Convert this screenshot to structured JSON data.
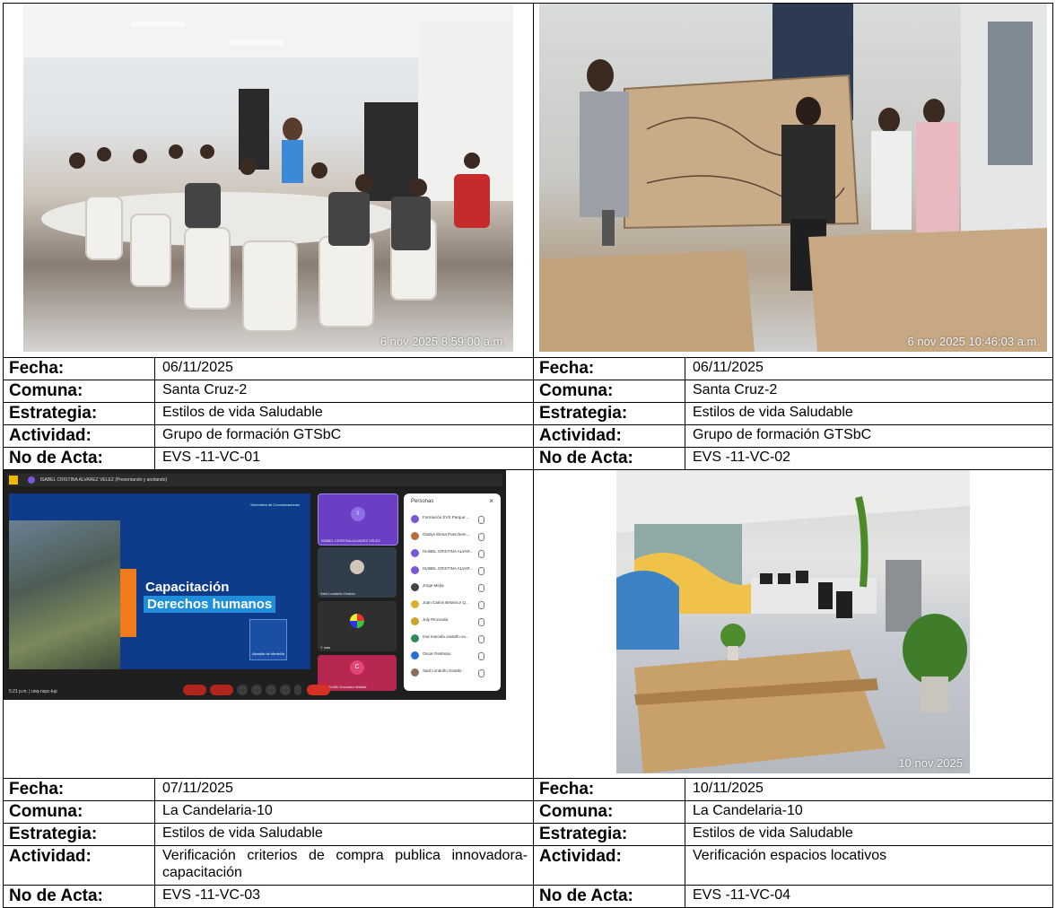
{
  "labels": {
    "fecha": "Fecha:",
    "comuna": "Comuna:",
    "estrategia": "Estrategia:",
    "actividad": "Actividad:",
    "acta": "No de Acta:"
  },
  "records": [
    {
      "photo_stamp": "6 nov 2025 8:59:00 a.m.",
      "fecha": "06/11/2025",
      "comuna": "Santa Cruz-2",
      "estrategia": "Estilos de vida Saludable",
      "actividad": "Grupo de formación GTSbC",
      "acta": "EVS -11-VC-01"
    },
    {
      "photo_stamp": "6 nov 2025 10:46:03 a.m.",
      "fecha": "06/11/2025",
      "comuna": "Santa Cruz-2",
      "estrategia": "Estilos de vida Saludable",
      "actividad": "Grupo de formación GTSbC",
      "acta": "EVS -11-VC-02"
    },
    {
      "fecha": "07/11/2025",
      "comuna": "La Candelaria-10",
      "estrategia": "Estilos de vida Saludable",
      "actividad": "Verificación criterios de compra publica innovadora- capacitación",
      "acta": "EVS -11-VC-03"
    },
    {
      "photo_stamp": "10 nov 2025",
      "fecha": "10/11/2025",
      "comuna": "La Candelaria-10",
      "estrategia": "Estilos de vida Saludable",
      "actividad": "Verificación espacios locativos",
      "acta": "EVS -11-VC-04"
    }
  ],
  "meeting": {
    "presenter_bar": "ISABEL CRISTINA ALVAREZ VELEZ (Presentando y anotando)",
    "slide_title_1": "Capacitación",
    "slide_title_2": "Derechos humanos",
    "slide_secretaria": "Secretaría de Comunicaciones",
    "slide_logo": "Alcaldía de Medellín",
    "tile_1": "ISABEL CRISTINA ALVAREZ VELEZ",
    "tile_1_initial": "I",
    "tile_2": "Said Londoño Giraldo",
    "tile_3": "Y más",
    "tile_4": "Cruz Erdith Gonzalez Madrid",
    "tile_4_initial": "C",
    "people_title": "Personas",
    "people_close": "×",
    "participants": [
      "Formación EVS Parque ...",
      "Gladys Elena Puerchem...",
      "ISABEL CRISTINA ALVAR...",
      "ISABEL CRISTINA ALVAR...",
      "Jorge Mejía",
      "Juan Carlos Betancur Q...",
      "July Pinzonda",
      "Ima marcela castaño va...",
      "Oscar Restrepo",
      "Said Londoño Giraldo"
    ],
    "participant_colors": [
      "#7b56d6",
      "#b86e3a",
      "#7b56d6",
      "#7b56d6",
      "#444444",
      "#d8b02a",
      "#c9a227",
      "#2e8b57",
      "#2a6fd8",
      "#8a6e5a"
    ],
    "clock": "5:21 p.m.",
    "meeting_code": "unq-nspc-kqi"
  }
}
